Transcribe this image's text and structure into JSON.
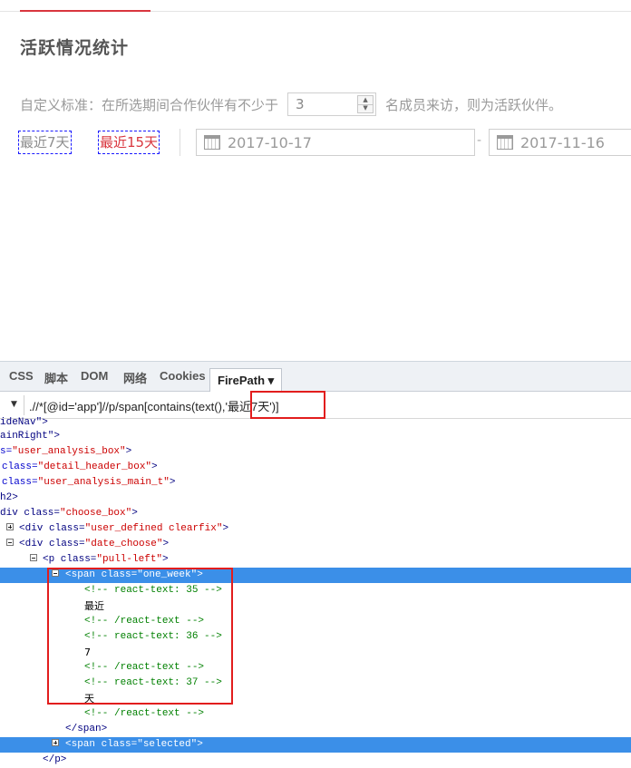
{
  "page": {
    "title": "活跃情况统计",
    "rule": {
      "prefix": "自定义标准：在所选期间合作伙伴有不少于",
      "value": "3",
      "suffix": "名成员来访，则为活跃伙伴。"
    },
    "quick_ranges": [
      {
        "label": "最近7天"
      },
      {
        "label": "最近15天"
      }
    ],
    "start_date": "2017-10-17",
    "end_date": "2017-11-16",
    "date_separator": "-"
  },
  "firebug": {
    "tabs": [
      "CSS",
      "脚本",
      "DOM",
      "网络",
      "Cookies",
      "FirePath ▾"
    ],
    "active_tab": "FirePath",
    "xpath_prefix": ".//*[@id='app']//p/span[contains(text(),",
    "xpath_highlight": "'最近7天')]",
    "colors": {
      "selection": "#3b8fe8",
      "highlight_box": "#e21d1d"
    },
    "tree": {
      "l0_tag": "ideNav\">",
      "l1_tag": "ainRight\">",
      "l2_pre": "s=",
      "l2_val": "\"user_analysis_box\"",
      "l2_close": ">",
      "l3_tag": "class=",
      "l3_val": "\"detail_header_box\"",
      "l3_close": ">",
      "l4_tag": "class=",
      "l4_val": "\"user_analysis_main_t\"",
      "l4_close": ">",
      "l5_tag": "h2>",
      "l6_tag": "div class=",
      "l6_val": "\"choose_box\"",
      "l6_close": ">",
      "l7_tag": "<div class=",
      "l7_val": "\"user_defined clearfix\"",
      "l7_close": ">",
      "l8_tag": "<div class=",
      "l8_val": "\"date_choose\"",
      "l8_close": ">",
      "l9_tag": "<p class=",
      "l9_val": "\"pull-left\"",
      "l9_close": ">",
      "l10_tag": "<span class=",
      "l10_val": "\"one_week\"",
      "l10_close": ">",
      "c1": "<!-- react-text: 35 -->",
      "t1": "最近",
      "c2": "<!-- /react-text -->",
      "c3": "<!-- react-text: 36 -->",
      "t2": "7",
      "c4": "<!-- /react-text -->",
      "c5": "<!-- react-text: 37 -->",
      "t3": "天",
      "c6": "<!-- /react-text -->",
      "close_span": "</span>",
      "l20_tag": "<span class=",
      "l20_val": "\"selected\"",
      "l20_close": ">",
      "close_p": "</p>"
    }
  }
}
